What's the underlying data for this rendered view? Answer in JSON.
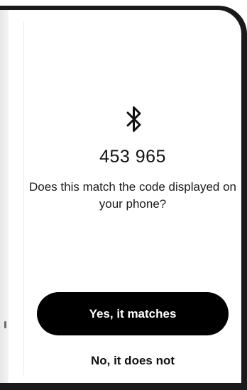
{
  "pairing": {
    "icon": "bluetooth-icon",
    "code": "453 965",
    "question": "Does this match the code displayed on your phone?"
  },
  "actions": {
    "confirm_label": "Yes, it matches",
    "reject_label": "No, it does not"
  },
  "colors": {
    "primary_button_bg": "#000000",
    "primary_button_text": "#ffffff",
    "device_frame": "#1a1a1c",
    "text": "#111111"
  }
}
